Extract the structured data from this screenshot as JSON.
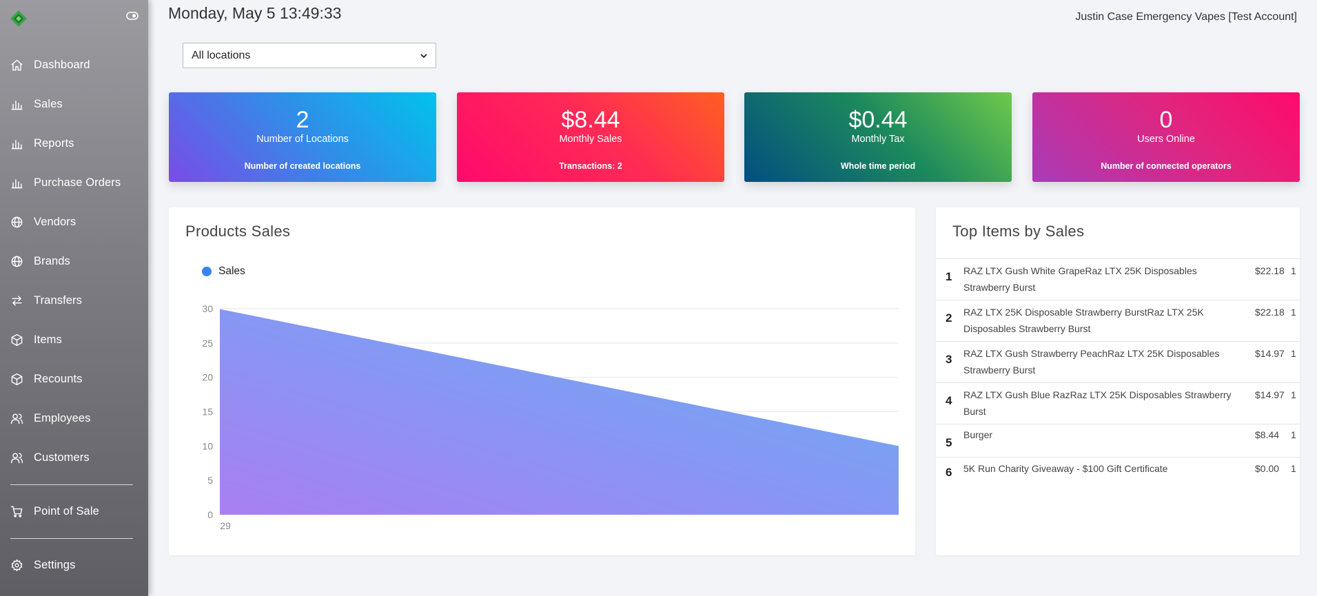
{
  "header": {
    "datetime": "Monday, May 5 13:49:33",
    "account": "Justin Case Emergency Vapes [Test Account]"
  },
  "location_select": {
    "value": "All locations"
  },
  "sidebar": {
    "items": [
      {
        "label": "Dashboard",
        "icon": "home-icon"
      },
      {
        "label": "Sales",
        "icon": "bar-chart-icon"
      },
      {
        "label": "Reports",
        "icon": "bar-chart-icon"
      },
      {
        "label": "Purchase Orders",
        "icon": "bar-chart-icon"
      },
      {
        "label": "Vendors",
        "icon": "globe-icon"
      },
      {
        "label": "Brands",
        "icon": "globe-icon"
      },
      {
        "label": "Transfers",
        "icon": "transfer-icon"
      },
      {
        "label": "Items",
        "icon": "box-icon"
      },
      {
        "label": "Recounts",
        "icon": "box-icon"
      },
      {
        "label": "Employees",
        "icon": "users-icon"
      },
      {
        "label": "Customers",
        "icon": "users-icon"
      }
    ],
    "pos": {
      "label": "Point of Sale",
      "icon": "cart-icon"
    },
    "settings": {
      "label": "Settings",
      "icon": "gear-icon"
    }
  },
  "cards": [
    {
      "value": "2",
      "name": "Number of Locations",
      "sub": "Number of created locations"
    },
    {
      "value": "$8.44",
      "name": "Monthly Sales",
      "sub": "Transactions: 2"
    },
    {
      "value": "$0.44",
      "name": "Monthly Tax",
      "sub": "Whole time period"
    },
    {
      "value": "0",
      "name": "Users Online",
      "sub": "Number of connected operators"
    }
  ],
  "products_sales": {
    "title": "Products Sales"
  },
  "chart_data": {
    "type": "area",
    "title": "Products Sales",
    "series": [
      {
        "name": "Sales",
        "values": [
          29.94,
          10.0
        ]
      }
    ],
    "x": [
      "29",
      ""
    ],
    "xtick_labels": [
      "29"
    ],
    "ylim": [
      0,
      30
    ],
    "yticks": [
      0,
      5,
      10,
      15,
      20,
      25,
      30
    ],
    "grid": true,
    "legend": "top-left",
    "colors": {
      "top_right": "#63b0f4",
      "bottom_left": "#a97ff2",
      "legend_dot": "#3a84ee"
    }
  },
  "top_items": {
    "title": "Top Items by Sales",
    "rows": [
      {
        "rank": "1",
        "name": "RAZ LTX Gush White GrapeRaz LTX 25K Disposables Strawberry Burst",
        "price": "$22.18",
        "qty": "1"
      },
      {
        "rank": "2",
        "name": "RAZ LTX 25K Disposable Strawberry BurstRaz LTX 25K Disposables Strawberry Burst",
        "price": "$22.18",
        "qty": "1"
      },
      {
        "rank": "3",
        "name": "RAZ LTX Gush Strawberry PeachRaz LTX 25K Disposables Strawberry Burst",
        "price": "$14.97",
        "qty": "1"
      },
      {
        "rank": "4",
        "name": "RAZ LTX Gush Blue RazRaz LTX 25K Disposables Strawberry Burst",
        "price": "$14.97",
        "qty": "1"
      },
      {
        "rank": "5",
        "name": "Burger",
        "price": "$8.44",
        "qty": "1"
      },
      {
        "rank": "6",
        "name": "5K Run Charity Giveaway - $100 Gift Certificate",
        "price": "$0.00",
        "qty": "1"
      }
    ]
  }
}
